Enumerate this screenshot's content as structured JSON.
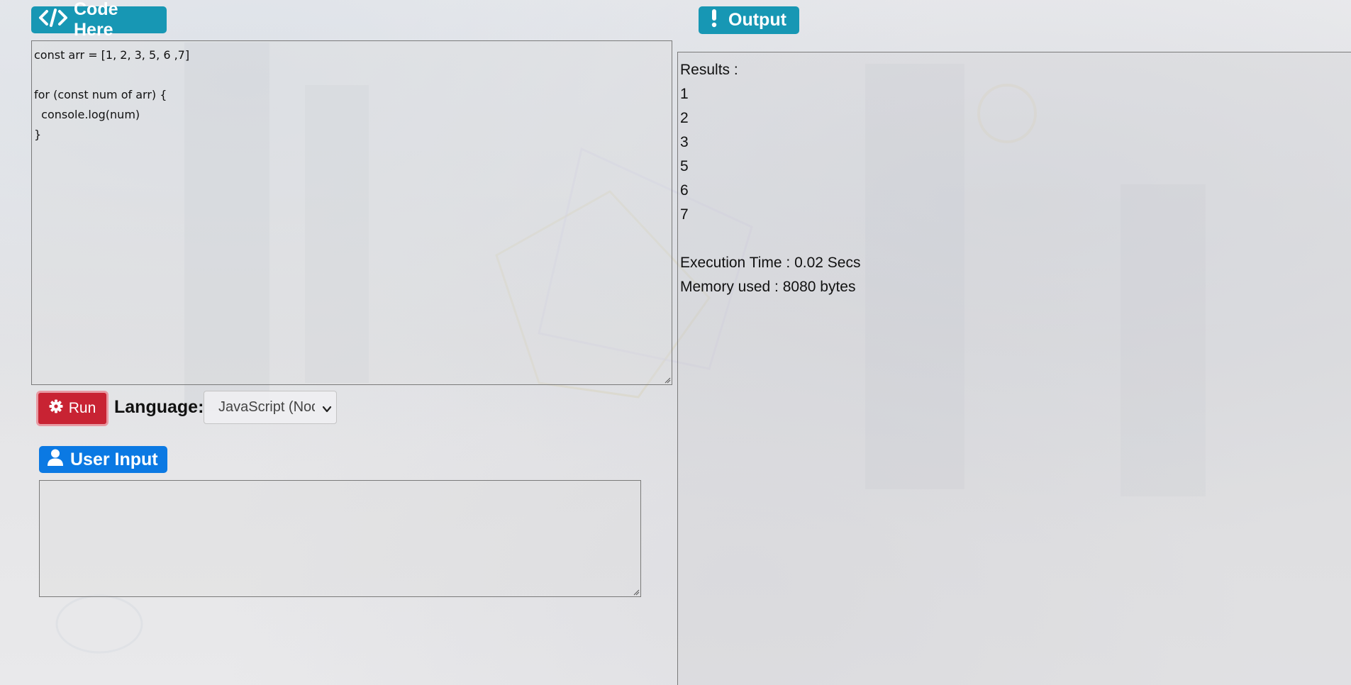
{
  "header": {
    "code_label": "Code Here",
    "output_label": "Output",
    "user_input_label": "User Input"
  },
  "editor": {
    "code": "const arr = [1, 2, 3, 5, 6 ,7]\n\nfor (const num of arr) {\n  console.log(num)\n}"
  },
  "controls": {
    "run_label": "Run",
    "language_label": "Language:",
    "language_value": "JavaScript (Node.js)"
  },
  "user_input": {
    "value": ""
  },
  "output": {
    "results_label": "Results :",
    "lines": [
      "1",
      "2",
      "3",
      "5",
      "6",
      "7"
    ],
    "execution_time": "Execution Time : 0.02 Secs",
    "memory_used": "Memory used : 8080 bytes"
  },
  "colors": {
    "badge_teal": "#1797b4",
    "badge_blue": "#0b79e3",
    "run_red": "#c82333"
  },
  "icons": {
    "code": "code-icon",
    "output": "exclamation-icon",
    "user": "user-icon",
    "run": "gear-icon"
  }
}
